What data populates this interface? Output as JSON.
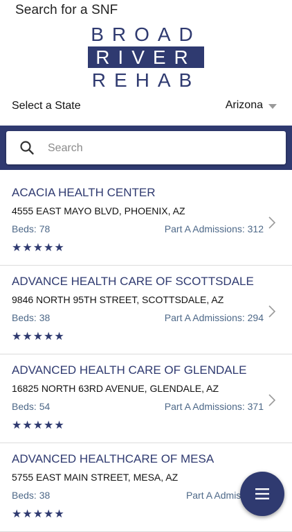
{
  "header": {
    "title": "Search for a SNF"
  },
  "logo": {
    "line1": "BROAD",
    "line2": "RIVER",
    "line3": "REHAB"
  },
  "state_select": {
    "label": "Select a State",
    "value": "Arizona"
  },
  "search": {
    "placeholder": "Search",
    "value": ""
  },
  "facilities": [
    {
      "name": "ACACIA HEALTH CENTER",
      "address": "4555 EAST MAYO BLVD, PHOENIX, AZ",
      "beds": "Beds: 78",
      "admissions": "Part A Admissions: 312",
      "stars": "★★★★★",
      "rating": 5
    },
    {
      "name": "ADVANCE HEALTH CARE OF SCOTTSDALE",
      "address": "9846 NORTH 95TH STREET, SCOTTSDALE, AZ",
      "beds": "Beds: 38",
      "admissions": "Part A Admissions: 294",
      "stars": "★★★★★",
      "rating": 5
    },
    {
      "name": "ADVANCED HEALTH CARE OF GLENDALE",
      "address": "16825 NORTH 63RD AVENUE, GLENDALE, AZ",
      "beds": "Beds: 54",
      "admissions": "Part A Admissions: 371",
      "stars": "★★★★★",
      "rating": 5
    },
    {
      "name": "ADVANCED HEALTHCARE OF MESA",
      "address": "5755 EAST MAIN STREET, MESA, AZ",
      "beds": "Beds: 38",
      "admissions": "Part A Admissions",
      "stars": "★★★★★",
      "rating": 5
    }
  ],
  "icons": {
    "search": "search-icon",
    "chevron": "chevron-right-icon",
    "menu": "menu-icon",
    "dropdown": "caret-down-icon"
  },
  "colors": {
    "brand": "#2f3a70",
    "meta": "#4d6888"
  }
}
